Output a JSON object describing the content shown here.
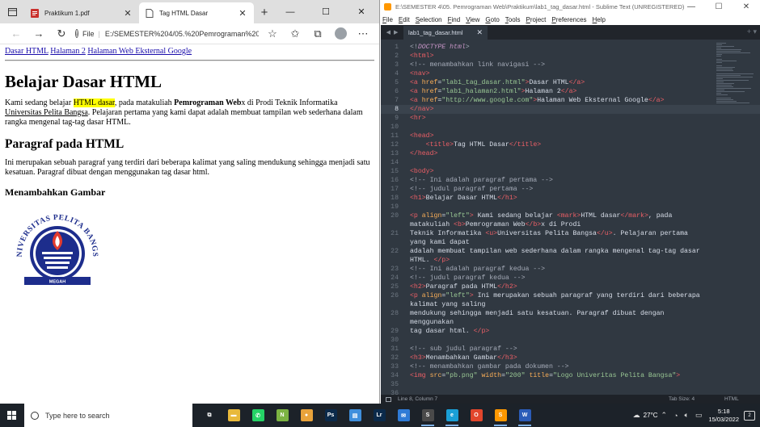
{
  "browser": {
    "tabs": [
      {
        "title": "Praktikum 1.pdf",
        "icon": "pdf-icon"
      },
      {
        "title": "Tag HTML Dasar",
        "icon": "page-icon"
      }
    ],
    "address": {
      "label": "File",
      "url": "E:/SEMESTER%204/05.%20Pemrograman%20W..."
    },
    "page": {
      "nav_links": [
        "Dasar HTML",
        "Halaman 2",
        "Halaman Web Eksternal Google"
      ],
      "h1": "Belajar Dasar HTML",
      "p1": {
        "before_mark": "Kami sedang belajar ",
        "mark": "HTML dasar",
        "after_mark": ", pada matakuliah ",
        "bold": "Pemrograman Web",
        "after_bold": "x di Prodi Teknik Informatika ",
        "underline": "Universitas Pelita Bangsa",
        "rest": ". Pelajaran pertama yang kami dapat adalah membuat tampilan web sederhana dalam rangka mengenal tag-tag dasar HTML."
      },
      "h2": "Paragraf pada HTML",
      "p2": "Ini merupakan sebuah paragraf yang terdiri dari beberapa kalimat yang saling mendukung sehingga menjadi satu kesatuan. Paragraf dibuat dengan menggunakan tag dasar html.",
      "h3": "Menambahkan Gambar",
      "logo": {
        "top_text": "UNIVERSITAS PELITA BANGSA",
        "band_text": "MEGAH",
        "primary_color": "#1d2d8c",
        "flame_color": "#e23b2e"
      }
    }
  },
  "sublime": {
    "title": "E:\\SEMESTER 4\\05. Pemrograman Web\\Praktikum\\lab1_tag_dasar.html - Sublime Text (UNREGISTERED)",
    "menu": [
      "File",
      "Edit",
      "Selection",
      "Find",
      "View",
      "Goto",
      "Tools",
      "Project",
      "Preferences",
      "Help"
    ],
    "tab": "lab1_tag_dasar.html",
    "current_line": 8,
    "code": [
      {
        "n": "1",
        "html": "<span class='c'>&lt;!</span><span class='k'>DOCTYPE html</span><span class='c'>&gt;</span>"
      },
      {
        "n": "2",
        "html": "<span class='t'>&lt;html&gt;</span>"
      },
      {
        "n": "3",
        "html": "<span class='c'>&lt;!-- menambahkan link navigasi --&gt;</span>"
      },
      {
        "n": "4",
        "html": "<span class='t'>&lt;nav&gt;</span>"
      },
      {
        "n": "5",
        "html": "<span class='t'>&lt;a</span> <span class='a'>href</span>=<span class='s'>\"lab1_tag_dasar.html\"</span><span class='t'>&gt;</span>Dasar HTML<span class='t'>&lt;/a&gt;</span>"
      },
      {
        "n": "6",
        "html": "<span class='t'>&lt;a</span> <span class='a'>href</span>=<span class='s'>\"lab1_halaman2.html\"</span><span class='t'>&gt;</span>Halaman 2<span class='t'>&lt;/a&gt;</span>"
      },
      {
        "n": "7",
        "html": "<span class='t'>&lt;a</span> <span class='a'>href</span>=<span class='s'>\"http://www.google.com\"</span><span class='t'>&gt;</span>Halaman Web Eksternal Google<span class='t'>&lt;/a&gt;</span>"
      },
      {
        "n": "8",
        "html": "<span class='t'>&lt;/nav&gt;</span>"
      },
      {
        "n": "9",
        "html": "<span class='t'>&lt;hr&gt;</span>"
      },
      {
        "n": "10",
        "html": ""
      },
      {
        "n": "11",
        "html": "<span class='t'>&lt;head&gt;</span>"
      },
      {
        "n": "12",
        "html": "    <span class='t'>&lt;title&gt;</span>Tag HTML Dasar<span class='t'>&lt;/title&gt;</span>"
      },
      {
        "n": "13",
        "html": "<span class='t'>&lt;/head&gt;</span>"
      },
      {
        "n": "14",
        "html": ""
      },
      {
        "n": "15",
        "html": "<span class='t'>&lt;body&gt;</span>"
      },
      {
        "n": "16",
        "html": "<span class='c'>&lt;!-- Ini adalah paragraf pertama --&gt;</span>"
      },
      {
        "n": "17",
        "html": "<span class='c'>&lt;!-- judul paragraf pertama --&gt;</span>"
      },
      {
        "n": "18",
        "html": "<span class='t'>&lt;h1&gt;</span>Belajar Dasar HTML<span class='t'>&lt;/h1&gt;</span>"
      },
      {
        "n": "19",
        "html": ""
      },
      {
        "n": "20",
        "html": "<span class='t'>&lt;p</span> <span class='a'>align</span>=<span class='s'>\"left\"</span><span class='t'>&gt;</span> Kami sedang belajar <span class='t'>&lt;mark&gt;</span>HTML dasar<span class='t'>&lt;/mark&gt;</span>, pada"
      },
      {
        "n": "",
        "html": "matakuliah <span class='t'>&lt;b&gt;</span>Pemrograman Web<span class='t'>&lt;/b&gt;</span>x di Prodi"
      },
      {
        "n": "21",
        "html": "Teknik Informatika <span class='t'>&lt;u&gt;</span>Universitas Pelita Bangsa<span class='t'>&lt;/u&gt;</span>. Pelajaran pertama"
      },
      {
        "n": "",
        "html": "yang kami dapat"
      },
      {
        "n": "22",
        "html": "adalah membuat tampilan web sederhana dalam rangka mengenal tag-tag dasar"
      },
      {
        "n": "",
        "html": "HTML. <span class='t'>&lt;/p&gt;</span>"
      },
      {
        "n": "23",
        "html": "<span class='c'>&lt;!-- Ini adalah paragraf kedua --&gt;</span>"
      },
      {
        "n": "24",
        "html": "<span class='c'>&lt;!-- judul paragraf kedua --&gt;</span>"
      },
      {
        "n": "25",
        "html": "<span class='t'>&lt;h2&gt;</span>Paragraf pada HTML<span class='t'>&lt;/h2&gt;</span>"
      },
      {
        "n": "26",
        "html": "<span class='t'>&lt;p</span> <span class='a'>align</span>=<span class='s'>\"left\"</span><span class='t'>&gt;</span> Ini merupakan sebuah paragraf yang terdiri dari beberapa"
      },
      {
        "n": "",
        "html": "kalimat yang saling"
      },
      {
        "n": "28",
        "html": "mendukung sehingga menjadi satu kesatuan. Paragraf dibuat dengan"
      },
      {
        "n": "",
        "html": "menggunakan"
      },
      {
        "n": "29",
        "html": "tag dasar html. <span class='t'>&lt;/p&gt;</span>"
      },
      {
        "n": "30",
        "html": ""
      },
      {
        "n": "31",
        "html": "<span class='c'>&lt;!-- sub judul paragraf --&gt;</span>"
      },
      {
        "n": "32",
        "html": "<span class='t'>&lt;h3&gt;</span>Menambahkan Gambar<span class='t'>&lt;/h3&gt;</span>"
      },
      {
        "n": "33",
        "html": "<span class='c'>&lt;!-- menambahkan gambar pada dokumen --&gt;</span>"
      },
      {
        "n": "34",
        "html": "<span class='t'>&lt;img</span> <span class='a'>src</span>=<span class='s'>\"pb.png\"</span> <span class='a'>width</span>=<span class='s'>\"200\"</span> <span class='a'>title</span>=<span class='s'>\"Logo Univeritas Pelita Bangsa\"</span><span class='t'>&gt;</span>"
      },
      {
        "n": "35",
        "html": ""
      },
      {
        "n": "36",
        "html": ""
      }
    ],
    "status": {
      "position": "Line 8, Column 7",
      "tab_size": "Tab Size: 4",
      "syntax": "HTML"
    }
  },
  "taskbar": {
    "search_placeholder": "Type here to search",
    "weather": "27°C",
    "time": "5:18",
    "date": "15/03/2022",
    "notifications": "2",
    "apps": [
      {
        "name": "task-view",
        "label": "⧉",
        "color": "#1c2229",
        "running": false
      },
      {
        "name": "file-explorer",
        "label": "▬",
        "color": "#e8b93b",
        "running": false
      },
      {
        "name": "whatsapp",
        "label": "✆",
        "color": "#25d366",
        "running": false
      },
      {
        "name": "notepad-plus",
        "label": "N",
        "color": "#7cb342",
        "running": false
      },
      {
        "name": "chrome",
        "label": "●",
        "color": "#e9a33b",
        "running": false
      },
      {
        "name": "photoshop",
        "label": "Ps",
        "color": "#0b2a4a",
        "running": false
      },
      {
        "name": "explorer-folder",
        "label": "▤",
        "color": "#3f8fdc",
        "running": false
      },
      {
        "name": "lightroom",
        "label": "Lr",
        "color": "#0b2a4a",
        "running": false
      },
      {
        "name": "mail",
        "label": "✉",
        "color": "#2f7bd6",
        "running": false
      },
      {
        "name": "sublime-text",
        "label": "S",
        "color": "#4a4a4a",
        "running": true
      },
      {
        "name": "edge",
        "label": "e",
        "color": "#1a9fd6",
        "running": true
      },
      {
        "name": "office",
        "label": "O",
        "color": "#e2462c",
        "running": false
      },
      {
        "name": "sublime-text-2",
        "label": "S",
        "color": "#ff9800",
        "running": true
      },
      {
        "name": "word",
        "label": "W",
        "color": "#2b5cb8",
        "running": true
      }
    ]
  }
}
